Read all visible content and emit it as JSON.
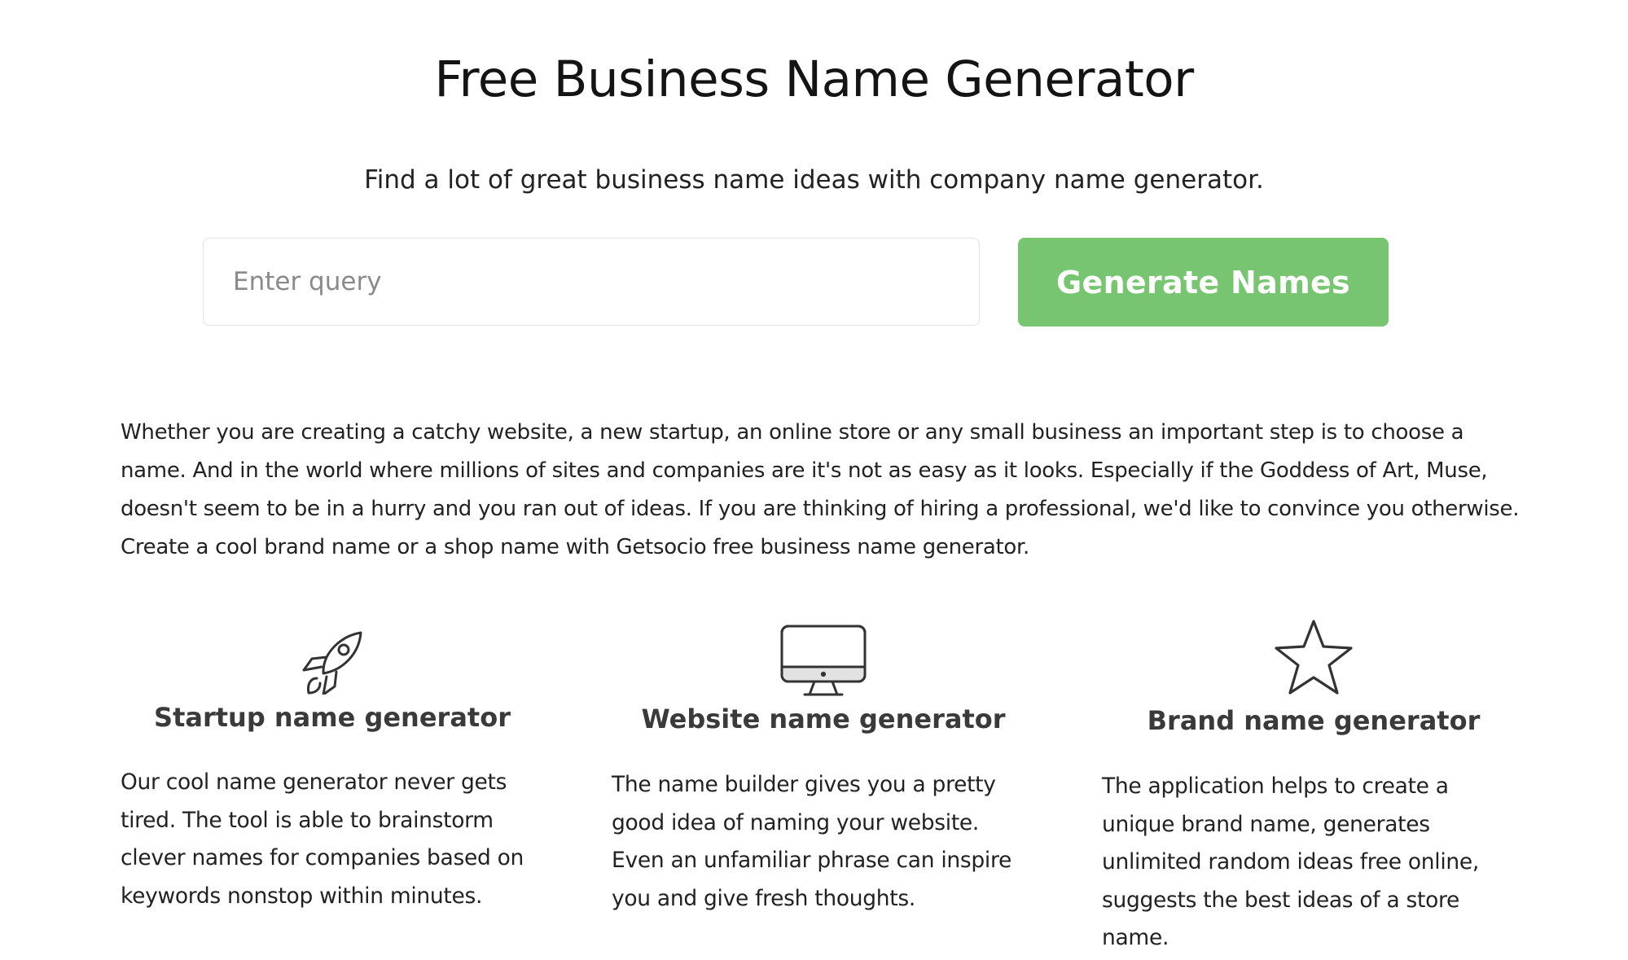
{
  "header": {
    "title": "Free Business Name Generator",
    "subtitle": "Find a lot of great business name ideas with company name generator."
  },
  "search": {
    "placeholder": "Enter query",
    "value": "",
    "button_label": "Generate Names"
  },
  "intro": {
    "text": "Whether you are creating a catchy website, a new startup, an online store or any small business an important step is to choose a name. And in the world where millions of sites and companies are it's not as easy as it looks. Especially if the Goddess of Art, Muse, doesn't seem to be in a hurry and you ran out of ideas. If you are thinking of hiring a professional, we'd like to convince you otherwise. Create a cool brand name or a shop name with Getsocio free business name generator."
  },
  "features": [
    {
      "icon": "rocket-icon",
      "title": "Startup name generator",
      "text": "Our cool name generator never gets tired. The tool is able to brainstorm clever names for companies based on keywords nonstop within minutes."
    },
    {
      "icon": "monitor-icon",
      "title": "Website name generator",
      "text": "The name builder gives you a pretty good idea of naming your website. Even an unfamiliar phrase can inspire you and give fresh thoughts."
    },
    {
      "icon": "star-icon",
      "title": "Brand name generator",
      "text": "The application helps to create a unique brand name, generates unlimited random ideas free online, suggests the best ideas of a store name."
    }
  ],
  "colors": {
    "button_background": "#77c571",
    "button_text": "#ffffff",
    "heading_text": "#141414",
    "feature_title_text": "#3a3a3a"
  }
}
